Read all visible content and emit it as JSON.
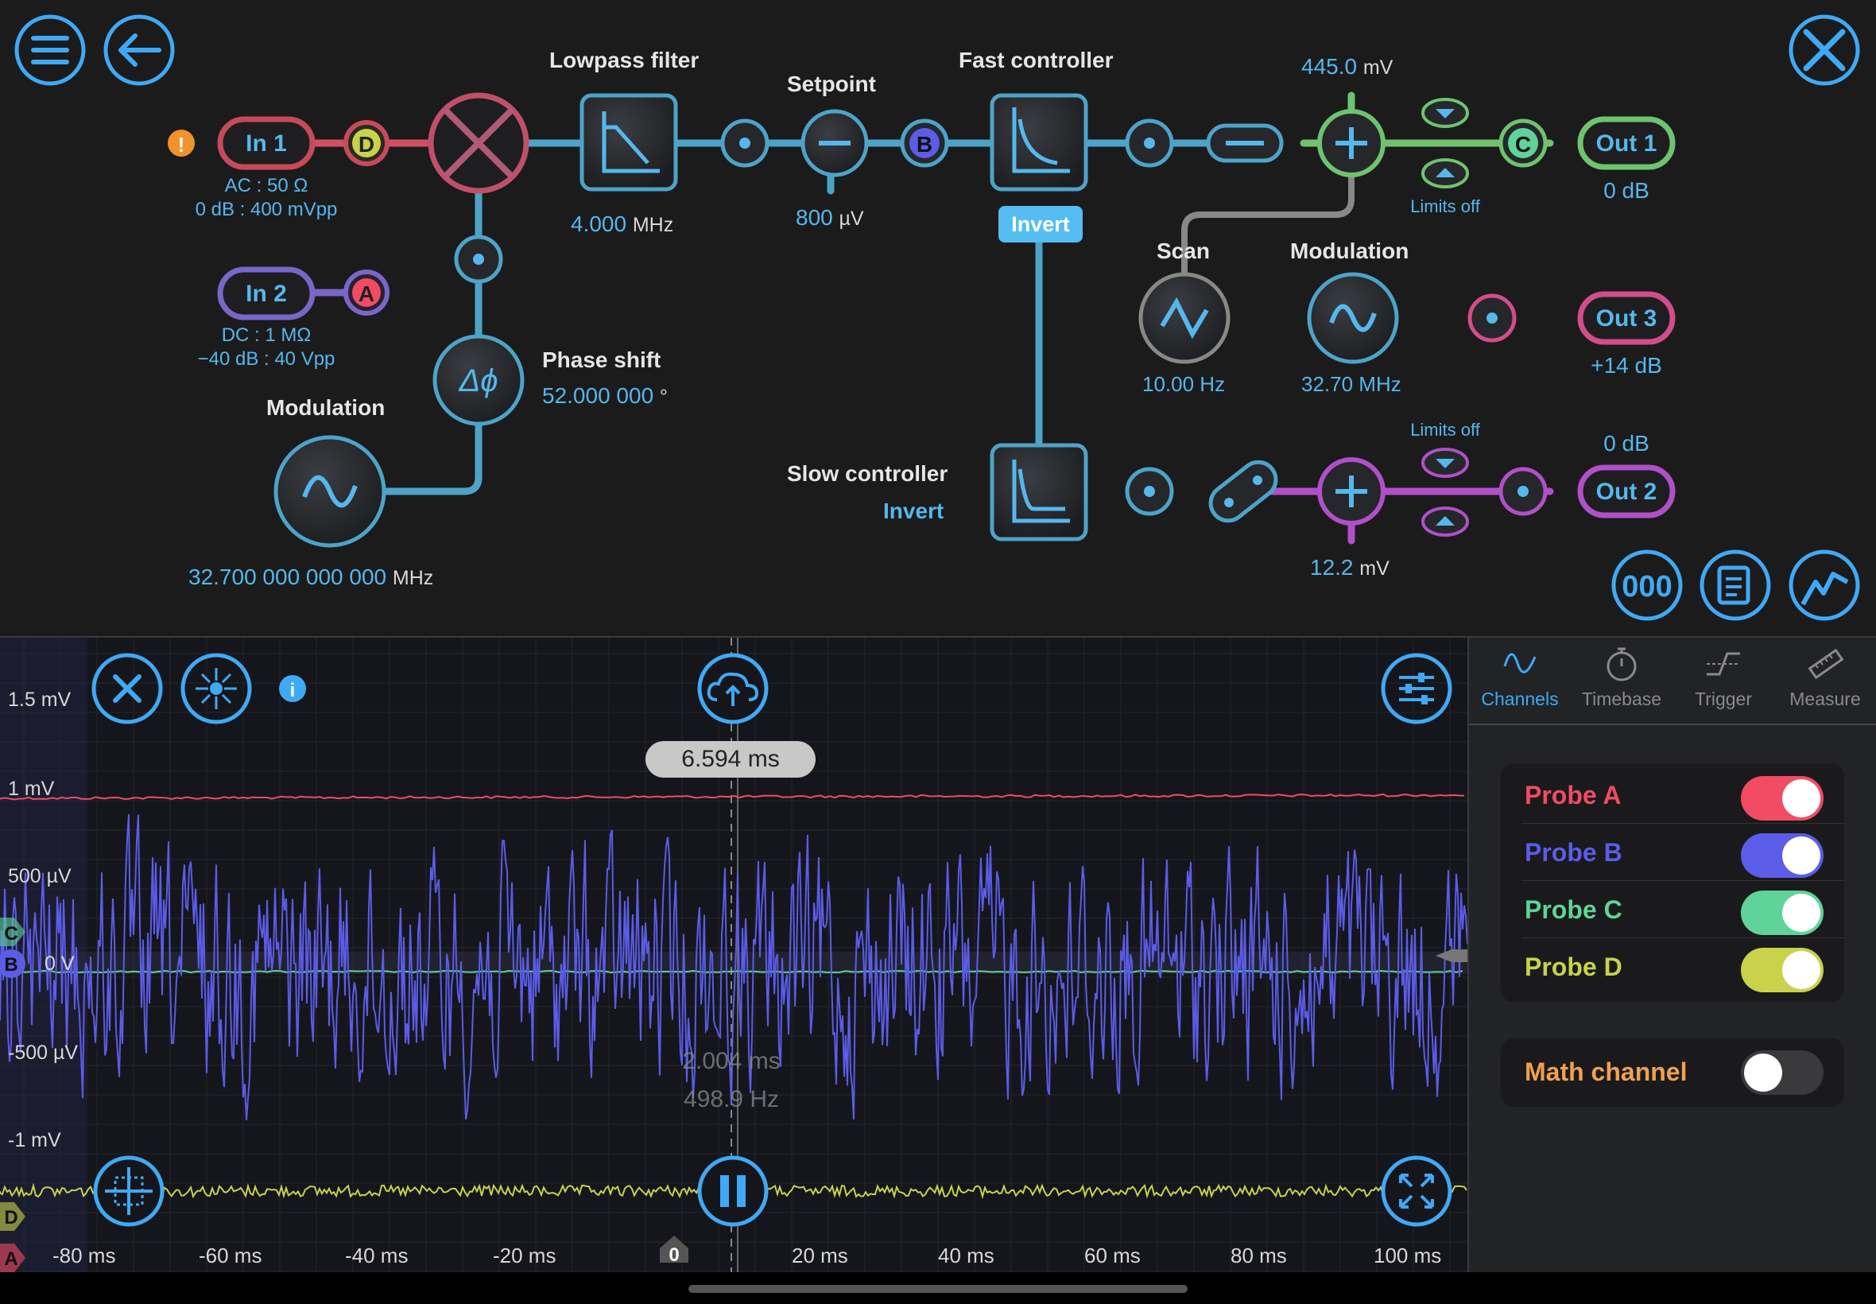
{
  "colors": {
    "accent": "#3fa9f5",
    "probe_a": "#f24b64",
    "probe_b": "#5b5ce8",
    "probe_c": "#5fd39a",
    "probe_d": "#c8d24a",
    "math": "#f0a050",
    "warning": "#f0932b"
  },
  "toolbar": {
    "menu_icon": "hamburger-icon",
    "back_icon": "arrow-left-icon",
    "settings_icon": "wrench-screwdriver-icon",
    "bottom_icons": [
      "decimal-display-icon",
      "notes-icon",
      "scope-icon"
    ]
  },
  "diagram": {
    "in1": {
      "label": "In 1",
      "line1": "AC : 50 Ω",
      "line2": "0 dB : 400 mVpp",
      "probe": "D"
    },
    "in2": {
      "label": "In 2",
      "line1": "DC : 1 MΩ",
      "line2": "−40 dB : 40 Vpp",
      "probe": "A"
    },
    "lowpass": {
      "title": "Lowpass filter",
      "value": "4.000",
      "unit": "MHz"
    },
    "setpoint": {
      "title": "Setpoint",
      "value": "800",
      "unit": "µV",
      "probe": "B"
    },
    "fast": {
      "title": "Fast controller",
      "invert": "Invert"
    },
    "slow": {
      "title": "Slow controller",
      "invert": "Invert"
    },
    "phase": {
      "title": "Phase shift",
      "value": "52.000 000",
      "unit": "°"
    },
    "mod_left": {
      "title": "Modulation",
      "value": "32.700 000 000 000",
      "unit": "MHz"
    },
    "scan": {
      "title": "Scan",
      "value": "10.00 Hz"
    },
    "mod_right": {
      "title": "Modulation",
      "value": "32.70 MHz"
    },
    "sum1": {
      "value": "445.0",
      "unit": "mV",
      "limits": "Limits off",
      "probe": "C"
    },
    "sum2": {
      "value": "12.2",
      "unit": "mV",
      "limits": "Limits off"
    },
    "out1": {
      "label": "Out 1",
      "gain": "0 dB"
    },
    "out2": {
      "label": "Out 2",
      "gain": "0 dB"
    },
    "out3": {
      "label": "Out 3",
      "gain": "+14 dB"
    }
  },
  "scope": {
    "cursor_time": "6.594 ms",
    "measure_period": "2.004 ms",
    "measure_freq": "498.9 Hz",
    "y_ticks": [
      "1.5 mV",
      "1 mV",
      "500 µV",
      "0 V",
      "-500 µV",
      "-1 mV"
    ],
    "x_ticks": [
      "-80 ms",
      "-60 ms",
      "-40 ms",
      "-20 ms",
      "20 ms",
      "40 ms",
      "60 ms",
      "80 ms",
      "100 ms"
    ],
    "zero_marker": "0",
    "channel_markers": [
      "B",
      "C",
      "D",
      "A"
    ],
    "tool_icons": [
      "close-icon",
      "laser-icon",
      "info-icon",
      "cloud-upload-icon",
      "sliders-icon",
      "crosshair-icon",
      "pause-icon",
      "expand-icon"
    ]
  },
  "panel": {
    "tabs": [
      {
        "label": "Channels",
        "icon": "sine-wave-icon",
        "active": true
      },
      {
        "label": "Timebase",
        "icon": "stopwatch-icon",
        "active": false
      },
      {
        "label": "Trigger",
        "icon": "trigger-edge-icon",
        "active": false
      },
      {
        "label": "Measure",
        "icon": "ruler-icon",
        "active": false
      }
    ],
    "probes": [
      {
        "label": "Probe A",
        "color": "#f24b64",
        "on": true
      },
      {
        "label": "Probe B",
        "color": "#5b5ce8",
        "on": true
      },
      {
        "label": "Probe C",
        "color": "#5fd39a",
        "on": true
      },
      {
        "label": "Probe D",
        "color": "#c8d24a",
        "on": true
      }
    ],
    "math": {
      "label": "Math channel",
      "on": false
    }
  }
}
